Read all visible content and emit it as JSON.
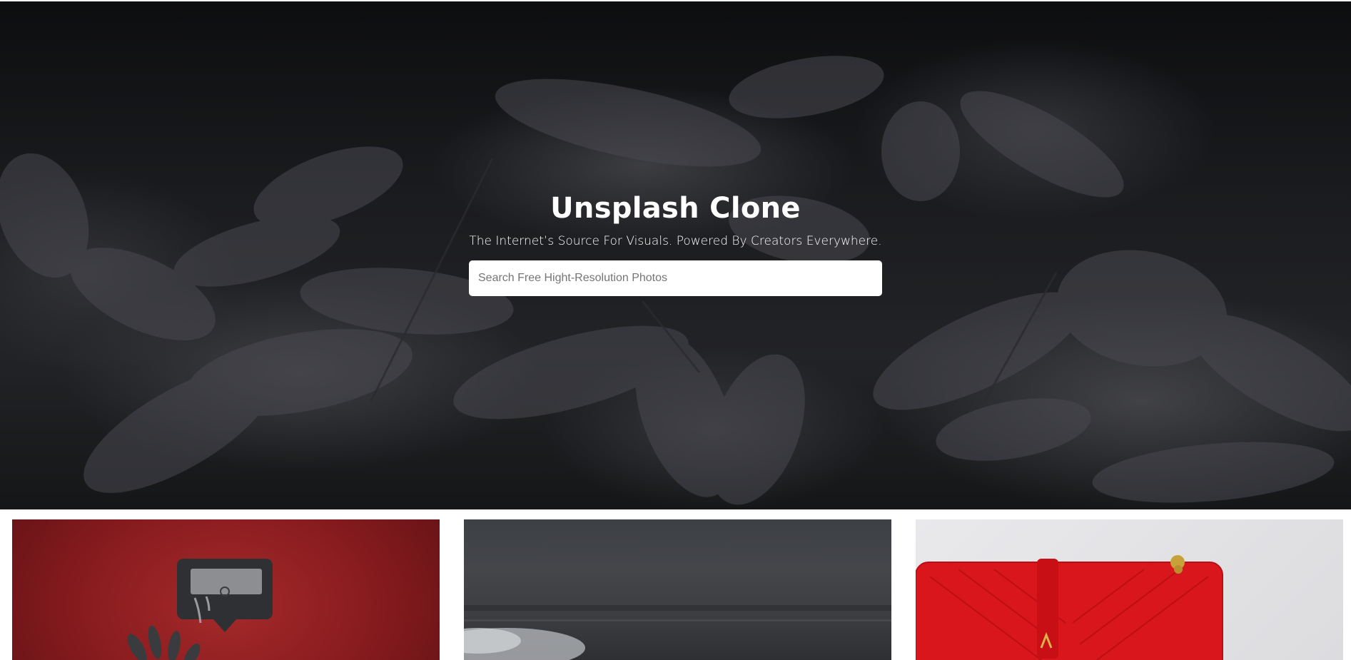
{
  "hero": {
    "title": "Unsplash Clone",
    "subtitle": "The Internet’s Source For Visuals. Powered By Creators Everywhere.",
    "search": {
      "placeholder": "Search Free Hight-Resolution Photos",
      "value": ""
    },
    "background_image": "dark wet leaves with water droplets"
  },
  "photos": [
    {
      "subject": "razor blade on speech bubble over red background"
    },
    {
      "subject": "dark hillside landscape with mist"
    },
    {
      "subject": "red quilted leather handbag with gold chain"
    }
  ],
  "colors": {
    "hero_text": "#ffffff",
    "search_background": "#ffffff",
    "placeholder_text": "#757575"
  }
}
